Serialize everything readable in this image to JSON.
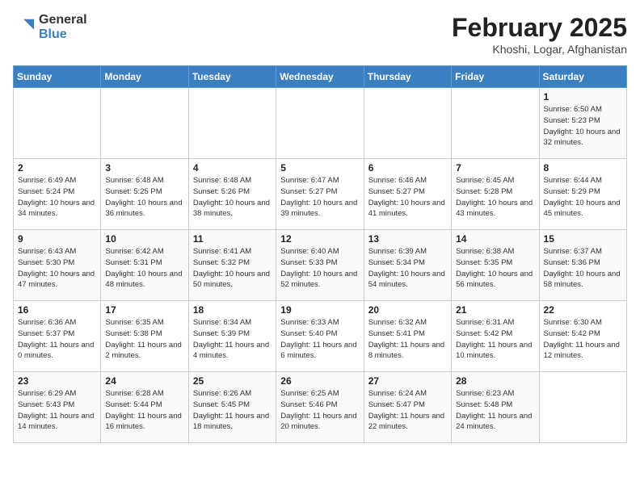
{
  "header": {
    "logo_general": "General",
    "logo_blue": "Blue",
    "title": "February 2025",
    "subtitle": "Khoshi, Logar, Afghanistan"
  },
  "days_of_week": [
    "Sunday",
    "Monday",
    "Tuesday",
    "Wednesday",
    "Thursday",
    "Friday",
    "Saturday"
  ],
  "weeks": [
    [
      {
        "day": "",
        "info": ""
      },
      {
        "day": "",
        "info": ""
      },
      {
        "day": "",
        "info": ""
      },
      {
        "day": "",
        "info": ""
      },
      {
        "day": "",
        "info": ""
      },
      {
        "day": "",
        "info": ""
      },
      {
        "day": "1",
        "info": "Sunrise: 6:50 AM\nSunset: 5:23 PM\nDaylight: 10 hours and 32 minutes."
      }
    ],
    [
      {
        "day": "2",
        "info": "Sunrise: 6:49 AM\nSunset: 5:24 PM\nDaylight: 10 hours and 34 minutes."
      },
      {
        "day": "3",
        "info": "Sunrise: 6:48 AM\nSunset: 5:25 PM\nDaylight: 10 hours and 36 minutes."
      },
      {
        "day": "4",
        "info": "Sunrise: 6:48 AM\nSunset: 5:26 PM\nDaylight: 10 hours and 38 minutes."
      },
      {
        "day": "5",
        "info": "Sunrise: 6:47 AM\nSunset: 5:27 PM\nDaylight: 10 hours and 39 minutes."
      },
      {
        "day": "6",
        "info": "Sunrise: 6:46 AM\nSunset: 5:27 PM\nDaylight: 10 hours and 41 minutes."
      },
      {
        "day": "7",
        "info": "Sunrise: 6:45 AM\nSunset: 5:28 PM\nDaylight: 10 hours and 43 minutes."
      },
      {
        "day": "8",
        "info": "Sunrise: 6:44 AM\nSunset: 5:29 PM\nDaylight: 10 hours and 45 minutes."
      }
    ],
    [
      {
        "day": "9",
        "info": "Sunrise: 6:43 AM\nSunset: 5:30 PM\nDaylight: 10 hours and 47 minutes."
      },
      {
        "day": "10",
        "info": "Sunrise: 6:42 AM\nSunset: 5:31 PM\nDaylight: 10 hours and 48 minutes."
      },
      {
        "day": "11",
        "info": "Sunrise: 6:41 AM\nSunset: 5:32 PM\nDaylight: 10 hours and 50 minutes."
      },
      {
        "day": "12",
        "info": "Sunrise: 6:40 AM\nSunset: 5:33 PM\nDaylight: 10 hours and 52 minutes."
      },
      {
        "day": "13",
        "info": "Sunrise: 6:39 AM\nSunset: 5:34 PM\nDaylight: 10 hours and 54 minutes."
      },
      {
        "day": "14",
        "info": "Sunrise: 6:38 AM\nSunset: 5:35 PM\nDaylight: 10 hours and 56 minutes."
      },
      {
        "day": "15",
        "info": "Sunrise: 6:37 AM\nSunset: 5:36 PM\nDaylight: 10 hours and 58 minutes."
      }
    ],
    [
      {
        "day": "16",
        "info": "Sunrise: 6:36 AM\nSunset: 5:37 PM\nDaylight: 11 hours and 0 minutes."
      },
      {
        "day": "17",
        "info": "Sunrise: 6:35 AM\nSunset: 5:38 PM\nDaylight: 11 hours and 2 minutes."
      },
      {
        "day": "18",
        "info": "Sunrise: 6:34 AM\nSunset: 5:39 PM\nDaylight: 11 hours and 4 minutes."
      },
      {
        "day": "19",
        "info": "Sunrise: 6:33 AM\nSunset: 5:40 PM\nDaylight: 11 hours and 6 minutes."
      },
      {
        "day": "20",
        "info": "Sunrise: 6:32 AM\nSunset: 5:41 PM\nDaylight: 11 hours and 8 minutes."
      },
      {
        "day": "21",
        "info": "Sunrise: 6:31 AM\nSunset: 5:42 PM\nDaylight: 11 hours and 10 minutes."
      },
      {
        "day": "22",
        "info": "Sunrise: 6:30 AM\nSunset: 5:42 PM\nDaylight: 11 hours and 12 minutes."
      }
    ],
    [
      {
        "day": "23",
        "info": "Sunrise: 6:29 AM\nSunset: 5:43 PM\nDaylight: 11 hours and 14 minutes."
      },
      {
        "day": "24",
        "info": "Sunrise: 6:28 AM\nSunset: 5:44 PM\nDaylight: 11 hours and 16 minutes."
      },
      {
        "day": "25",
        "info": "Sunrise: 6:26 AM\nSunset: 5:45 PM\nDaylight: 11 hours and 18 minutes."
      },
      {
        "day": "26",
        "info": "Sunrise: 6:25 AM\nSunset: 5:46 PM\nDaylight: 11 hours and 20 minutes."
      },
      {
        "day": "27",
        "info": "Sunrise: 6:24 AM\nSunset: 5:47 PM\nDaylight: 11 hours and 22 minutes."
      },
      {
        "day": "28",
        "info": "Sunrise: 6:23 AM\nSunset: 5:48 PM\nDaylight: 11 hours and 24 minutes."
      },
      {
        "day": "",
        "info": ""
      }
    ]
  ]
}
